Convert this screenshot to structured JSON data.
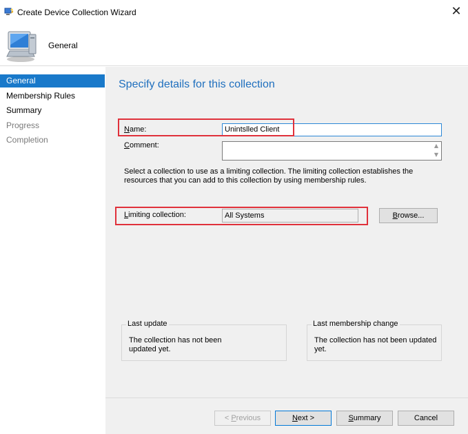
{
  "window": {
    "title": "Create Device Collection Wizard",
    "close_glyph": "✕"
  },
  "header": {
    "title": "General"
  },
  "nav": {
    "items": [
      {
        "label": "General",
        "state": "selected"
      },
      {
        "label": "Membership Rules",
        "state": "enabled"
      },
      {
        "label": "Summary",
        "state": "enabled"
      },
      {
        "label": "Progress",
        "state": "disabled"
      },
      {
        "label": "Completion",
        "state": "disabled"
      }
    ]
  },
  "main": {
    "heading": "Specify details for this collection",
    "name_label_u": "N",
    "name_label_rest": "ame:",
    "name_value": "Unintslled Client",
    "comment_label_u": "C",
    "comment_label_rest": "omment:",
    "comment_value": "",
    "description": "Select a collection to use as a limiting collection. The limiting collection establishes the resources that you can add to this collection by using membership rules.",
    "limiting_label_u": "L",
    "limiting_label_rest": "imiting collection:",
    "limiting_value": "All Systems",
    "browse_label_u": "B",
    "browse_label_rest": "rowse...",
    "last_update": {
      "title": "Last update",
      "text": "The collection has not been updated yet."
    },
    "last_membership_change": {
      "title": "Last membership change",
      "text": "The collection has not been updated yet."
    }
  },
  "footer": {
    "prev_label_pre": "< ",
    "prev_label_u": "P",
    "prev_label_rest": "revious",
    "next_label_u": "N",
    "next_label_rest": "ext >",
    "summary_label_u": "S",
    "summary_label_rest": "ummary",
    "cancel_label": "Cancel"
  },
  "colors": {
    "accent": "#1979ca",
    "heading": "#1f6fbe",
    "highlight_box": "#e0303a"
  }
}
